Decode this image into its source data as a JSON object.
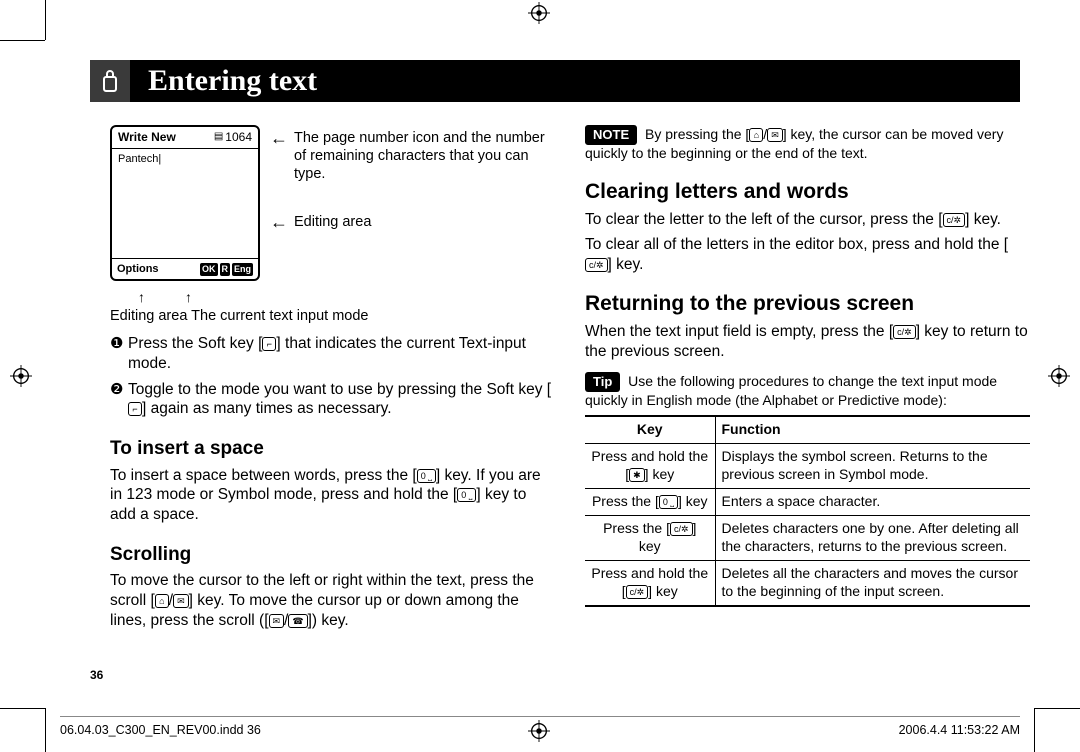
{
  "header": {
    "title": "Entering text"
  },
  "phone": {
    "title": "Write New",
    "count": "1064",
    "body_text": "Pantech|",
    "opt": "Options",
    "ok": "OK",
    "r": "R",
    "eng": "Eng"
  },
  "labels": {
    "top_arrow": "The page number icon and the number of remaining characters that you can type.",
    "mid_arrow": "Editing area",
    "below": "Editing area   The current text input mode"
  },
  "steps": {
    "s1": "Press the Soft key [   ] that indicates the current Text-input mode.",
    "s2": "Toggle to the mode you want to use by pressing the Soft key [   ] again as many times as necessary."
  },
  "insert_space": {
    "h": "To insert a space",
    "p": "To insert a space between words, press the [   ] key. If you are in 123 mode or Symbol mode, press and hold the [   ] key to add a space."
  },
  "scrolling": {
    "h": "Scrolling",
    "p": "To move the cursor to the left or right within the text, press the scroll [   /   ] key. To move the cursor up or down among the lines, press the scroll ([   /   ]) key."
  },
  "note": {
    "badge": "NOTE",
    "text": "By pressing the [   /   ] key, the cursor can be moved very quickly to the beginning or the end of the text."
  },
  "clearing": {
    "h": "Clearing letters and words",
    "p1": "To clear the letter to the left of the cursor, press the [   ] key.",
    "p2": "To clear all of the letters in the editor box, press and hold the [   ] key."
  },
  "returning": {
    "h": "Returning to the previous screen",
    "p": "When the text input field is empty, press the [   ] key to return to the previous screen."
  },
  "tip": {
    "badge": "Tip",
    "text": "Use the following procedures to change the text input mode quickly in English mode (the Alphabet or Predictive mode):"
  },
  "table": {
    "h_key": "Key",
    "h_func": "Function",
    "rows": [
      {
        "k": "Press and hold the [   ] key",
        "f": "Displays the symbol screen. Returns to the previous screen in Symbol mode."
      },
      {
        "k": "Press the [   ] key",
        "f": "Enters a space character."
      },
      {
        "k": "Press the [   ] key",
        "f": "Deletes characters one by one. After deleting all the characters, returns to the previous screen."
      },
      {
        "k": "Press and hold the [   ] key",
        "f": "Deletes all the characters and moves the cursor to the beginning of the input screen."
      }
    ]
  },
  "page_num": "36",
  "footer": {
    "left": "06.04.03_C300_EN_REV00.indd   36",
    "right": "2006.4.4   11:53:22 AM"
  }
}
